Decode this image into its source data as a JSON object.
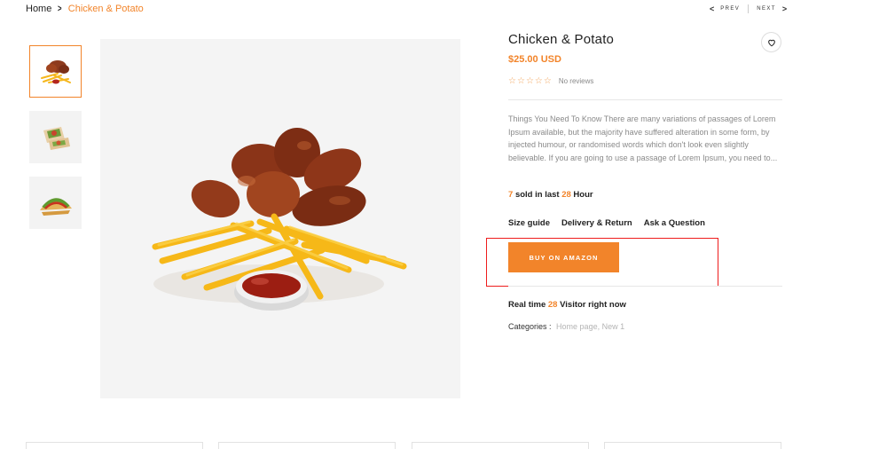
{
  "breadcrumb": {
    "home": "Home",
    "current": "Chicken & Potato"
  },
  "pager": {
    "prev": "PREV",
    "next": "NEXT"
  },
  "product": {
    "title": "Chicken & Potato",
    "price": "$25.00 USD",
    "stars": [
      "☆",
      "☆",
      "☆",
      "☆",
      "☆"
    ],
    "reviews": "No reviews",
    "description": "Things You Need To Know There are many variations of passages of Lorem Ipsum available, but the majority have suffered alteration in some form, by injected humour, or randomised words which don't look even slightly believable. If you are going to use a passage of Lorem Ipsum, you need to...",
    "sold": {
      "count": "7",
      "mid": "sold in last",
      "hours": "28",
      "suffix": "Hour"
    },
    "links": [
      "Size guide",
      "Delivery & Return",
      "Ask a Question"
    ],
    "buy_label": "BUY ON AMAZON",
    "visitors": {
      "prefix": "Real time",
      "count": "28",
      "suffix": "Visitor right now"
    },
    "categories": {
      "label": "Categories :",
      "value": "Home page, New 1"
    }
  },
  "thumbnails": [
    {
      "name": "chicken-fries",
      "active": true
    },
    {
      "name": "wrap",
      "active": false
    },
    {
      "name": "taco",
      "active": false
    }
  ],
  "colors": {
    "accent": "#f2842a",
    "highlight_border": "#ee1c1c"
  }
}
